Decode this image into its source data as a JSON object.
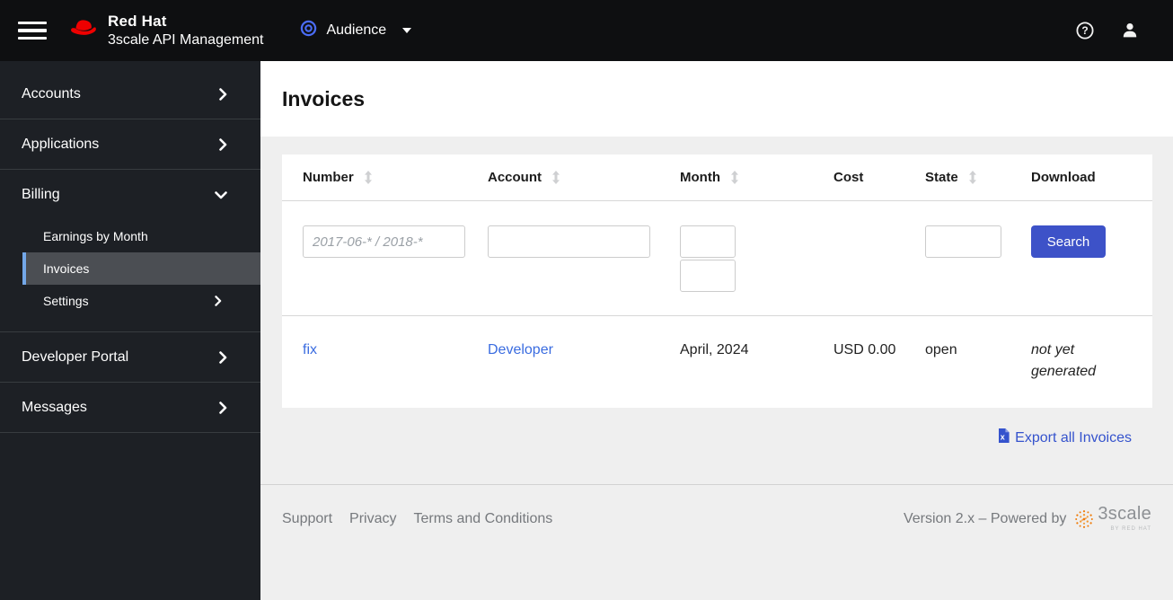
{
  "masthead": {
    "brand_line1": "Red Hat",
    "brand_line2": "3scale API Management",
    "context_selector": {
      "label": "Audience"
    }
  },
  "sidebar": {
    "items": [
      {
        "label": "Accounts",
        "expandable": true
      },
      {
        "label": "Applications",
        "expandable": true
      },
      {
        "label": "Billing",
        "expanded": true,
        "children": [
          {
            "label": "Earnings by Month"
          },
          {
            "label": "Invoices",
            "active": true
          },
          {
            "label": "Settings",
            "expandable": true
          }
        ]
      },
      {
        "label": "Developer Portal",
        "expandable": true
      },
      {
        "label": "Messages",
        "expandable": true
      }
    ]
  },
  "page": {
    "title": "Invoices"
  },
  "table": {
    "columns": [
      {
        "label": "Number",
        "sortable": true
      },
      {
        "label": "Account",
        "sortable": true
      },
      {
        "label": "Month",
        "sortable": true
      },
      {
        "label": "Cost",
        "sortable": false
      },
      {
        "label": "State",
        "sortable": true
      },
      {
        "label": "Download",
        "sortable": false
      }
    ],
    "filters": {
      "number_placeholder": "2017-06-* / 2018-*",
      "search_label": "Search"
    },
    "rows": [
      {
        "number": "fix",
        "account": "Developer",
        "month": "April, 2024",
        "cost": "USD 0.00",
        "state": "open",
        "download": "not yet generated"
      }
    ],
    "export_label": "Export all Invoices"
  },
  "footer": {
    "links": [
      "Support",
      "Privacy",
      "Terms and Conditions"
    ],
    "version_text": "Version 2.x – Powered by",
    "logo_text": "3scale",
    "logo_subtext": "BY RED HAT"
  },
  "colors": {
    "masthead_bg": "#0e0f11",
    "sidebar_bg": "#1d2025",
    "active_nav_bg": "#4b4e53",
    "active_nav_border": "#73a7e8",
    "brand_red": "#ee0000",
    "link_blue": "#3a6ce0",
    "button_indigo": "#3d52c8",
    "bullseye_blue": "#4a6cf5",
    "logo_orange": "#ef7b08",
    "content_bg": "#efefef"
  }
}
